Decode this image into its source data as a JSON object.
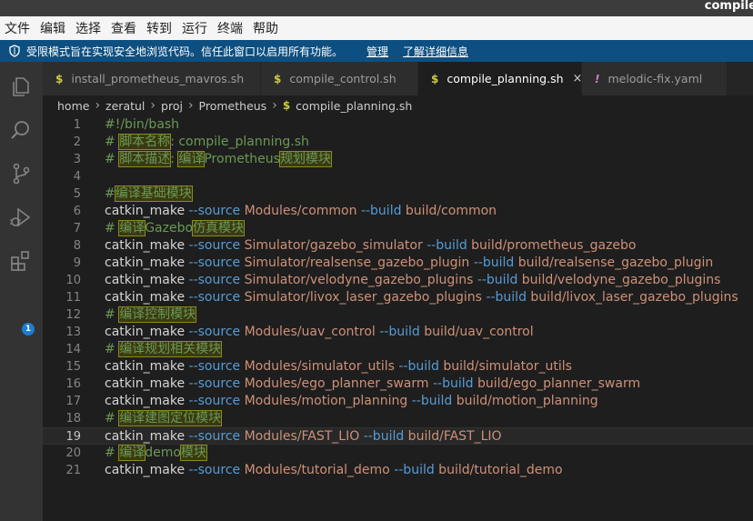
{
  "window": {
    "title": "compile"
  },
  "menu": [
    "文件",
    "编辑",
    "选择",
    "查看",
    "转到",
    "运行",
    "终端",
    "帮助"
  ],
  "banner": {
    "message": "受限模式旨在实现安全地浏览代码。信任此窗口以启用所有功能。",
    "manage": "管理",
    "learn_more": "了解详细信息"
  },
  "activity": {
    "extensions_badge": "1"
  },
  "tabs": [
    {
      "icon": "$",
      "label": "install_prometheus_mavros.sh",
      "active": false
    },
    {
      "icon": "$",
      "label": "compile_control.sh",
      "active": false
    },
    {
      "icon": "$",
      "label": "compile_planning.sh",
      "active": true,
      "close": "×"
    },
    {
      "icon": "!",
      "label": "melodic-fix.yaml",
      "active": false
    }
  ],
  "breadcrumb": {
    "parts": [
      "home",
      "zeratul",
      "proj",
      "Prometheus"
    ],
    "file_icon": "$",
    "file": "compile_planning.sh"
  },
  "editor": {
    "current_line": 19,
    "lines": [
      {
        "n": "1",
        "segs": [
          [
            "cm",
            "#!/bin/bash"
          ]
        ]
      },
      {
        "n": "2",
        "segs": [
          [
            "cm",
            "# "
          ],
          [
            "cmh",
            "脚本名称"
          ],
          [
            "cm",
            ": compile_planning.sh"
          ]
        ]
      },
      {
        "n": "3",
        "segs": [
          [
            "cm",
            "# "
          ],
          [
            "cmh",
            "脚本描述"
          ],
          [
            "cm",
            ": "
          ],
          [
            "cmh",
            "编译"
          ],
          [
            "cm",
            "Prometheus"
          ],
          [
            "cmh",
            "规划模块"
          ]
        ]
      },
      {
        "n": "4",
        "segs": []
      },
      {
        "n": "5",
        "segs": [
          [
            "cm",
            "#"
          ],
          [
            "cmh",
            "编译基础模块"
          ]
        ]
      },
      {
        "n": "6",
        "segs": [
          [
            "plain",
            "catkin_make "
          ],
          [
            "flag",
            "--source"
          ],
          [
            "str",
            " Modules/common "
          ],
          [
            "flag",
            "--build"
          ],
          [
            "str",
            " build/common"
          ]
        ]
      },
      {
        "n": "7",
        "segs": [
          [
            "cm",
            "# "
          ],
          [
            "cmh",
            "编译"
          ],
          [
            "cm",
            "Gazebo"
          ],
          [
            "cmh",
            "仿真模块"
          ]
        ]
      },
      {
        "n": "8",
        "segs": [
          [
            "plain",
            "catkin_make "
          ],
          [
            "flag",
            "--source"
          ],
          [
            "str",
            " Simulator/gazebo_simulator "
          ],
          [
            "flag",
            "--build"
          ],
          [
            "str",
            " build/prometheus_gazebo"
          ]
        ]
      },
      {
        "n": "9",
        "segs": [
          [
            "plain",
            "catkin_make "
          ],
          [
            "flag",
            "--source"
          ],
          [
            "str",
            " Simulator/realsense_gazebo_plugin "
          ],
          [
            "flag",
            "--build"
          ],
          [
            "str",
            " build/realsense_gazebo_plugin"
          ]
        ]
      },
      {
        "n": "10",
        "segs": [
          [
            "plain",
            "catkin_make "
          ],
          [
            "flag",
            "--source"
          ],
          [
            "str",
            " Simulator/velodyne_gazebo_plugins "
          ],
          [
            "flag",
            "--build"
          ],
          [
            "str",
            " build/velodyne_gazebo_plugins"
          ]
        ]
      },
      {
        "n": "11",
        "segs": [
          [
            "plain",
            "catkin_make "
          ],
          [
            "flag",
            "--source"
          ],
          [
            "str",
            " Simulator/livox_laser_gazebo_plugins "
          ],
          [
            "flag",
            "--build"
          ],
          [
            "str",
            " build/livox_laser_gazebo_plugins"
          ]
        ]
      },
      {
        "n": "12",
        "segs": [
          [
            "cm",
            "# "
          ],
          [
            "cmh",
            "编译控制模块"
          ]
        ]
      },
      {
        "n": "13",
        "segs": [
          [
            "plain",
            "catkin_make "
          ],
          [
            "flag",
            "--source"
          ],
          [
            "str",
            " Modules/uav_control "
          ],
          [
            "flag",
            "--build"
          ],
          [
            "str",
            " build/uav_control"
          ]
        ]
      },
      {
        "n": "14",
        "segs": [
          [
            "cm",
            "# "
          ],
          [
            "cmh",
            "编译规划相关模块"
          ]
        ]
      },
      {
        "n": "15",
        "segs": [
          [
            "plain",
            "catkin_make "
          ],
          [
            "flag",
            "--source"
          ],
          [
            "str",
            " Modules/simulator_utils "
          ],
          [
            "flag",
            "--build"
          ],
          [
            "str",
            " build/simulator_utils"
          ]
        ]
      },
      {
        "n": "16",
        "segs": [
          [
            "plain",
            "catkin_make "
          ],
          [
            "flag",
            "--source"
          ],
          [
            "str",
            " Modules/ego_planner_swarm "
          ],
          [
            "flag",
            "--build"
          ],
          [
            "str",
            " build/ego_planner_swarm"
          ]
        ]
      },
      {
        "n": "17",
        "segs": [
          [
            "plain",
            "catkin_make "
          ],
          [
            "flag",
            "--source"
          ],
          [
            "str",
            " Modules/motion_planning "
          ],
          [
            "flag",
            "--build"
          ],
          [
            "str",
            " build/motion_planning"
          ]
        ]
      },
      {
        "n": "18",
        "segs": [
          [
            "cm",
            "# "
          ],
          [
            "cmh",
            "编译建图定位模块"
          ]
        ]
      },
      {
        "n": "19",
        "segs": [
          [
            "plain",
            "catkin_make "
          ],
          [
            "flag",
            "--source"
          ],
          [
            "str",
            " Modules/FAST_LIO "
          ],
          [
            "flag",
            "--build"
          ],
          [
            "str",
            " build/FAST_LIO"
          ]
        ]
      },
      {
        "n": "20",
        "segs": [
          [
            "cm",
            "# "
          ],
          [
            "cmh",
            "编译"
          ],
          [
            "cm",
            "demo"
          ],
          [
            "cmh",
            "模块"
          ]
        ]
      },
      {
        "n": "21",
        "segs": [
          [
            "plain",
            "catkin_make "
          ],
          [
            "flag",
            "--source"
          ],
          [
            "str",
            " Modules/tutorial_demo "
          ],
          [
            "flag",
            "--build"
          ],
          [
            "str",
            " build/tutorial_demo"
          ]
        ]
      }
    ]
  }
}
